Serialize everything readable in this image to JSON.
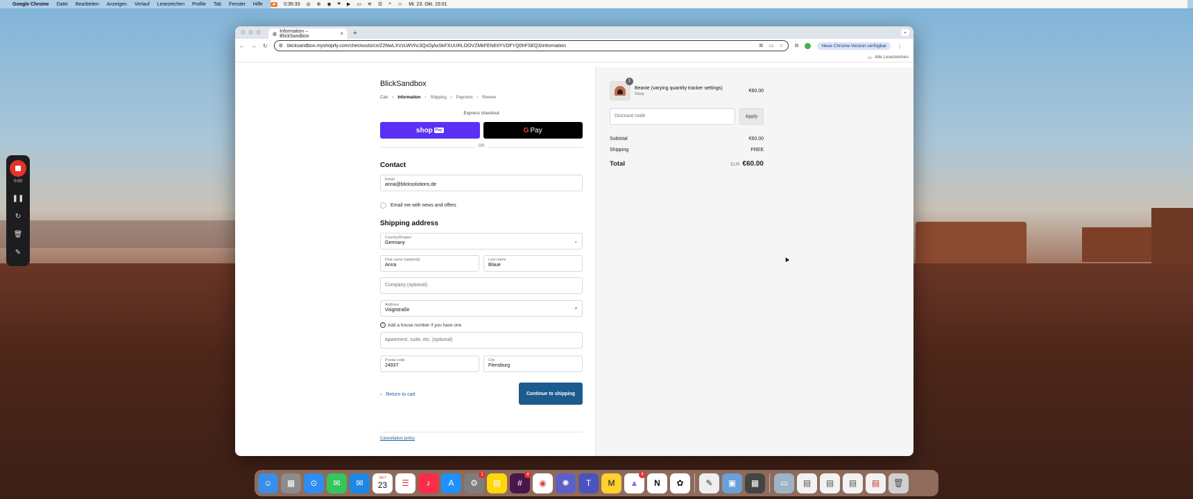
{
  "menubar": {
    "app": "Google Chrome",
    "items": [
      "Datei",
      "Bearbeiten",
      "Anzeigen",
      "Verlauf",
      "Lesezeichen",
      "Profile",
      "Tab",
      "Fenster",
      "Hilfe"
    ],
    "recording_time": "0:35:33",
    "datetime": "Mi. 23. Okt.  15:01"
  },
  "recorder": {
    "time": "0:00"
  },
  "browser": {
    "tab_title": "Information – BlickSandbox",
    "url": "blicksandbox.myshopify.com/checkouts/cn/Z2NwLXVzLWVhc3QxOjAxSkFXUURLOOVZMkFENEtlYVDFYQ0hFSEQ3/information",
    "update_label": "Neue Chrome-Version verfügbar",
    "bookmarks_label": "Alle Lesezeichen"
  },
  "checkout": {
    "store_name": "BlickSandbox",
    "breadcrumbs": [
      "Cart",
      "Information",
      "Shipping",
      "Payment",
      "Review"
    ],
    "express_label": "Express checkout",
    "shoppay_label": "shop",
    "shoppay_badge": "Pay",
    "gpay_label": "Pay",
    "or_label": "OR",
    "contact_heading": "Contact",
    "email_label": "Email",
    "email_value": "anna@blicksolutions.de",
    "newsletter_label": "Email me with news and offers",
    "shipping_heading": "Shipping address",
    "country_label": "Country/Region",
    "country_value": "Germany",
    "first_name_label": "First name (optional)",
    "first_name_value": "Anna",
    "last_name_label": "Last name",
    "last_name_value": "Blaue",
    "company_placeholder": "Company (optional)",
    "address_label": "Address",
    "address_value": "Voigtstraße",
    "address_hint": "Add a house number if you have one",
    "apartment_placeholder": "Apartment, suite, etc. (optional)",
    "postal_label": "Postal code",
    "postal_value": "24937",
    "city_label": "City",
    "city_value": "Flensburg",
    "return_label": "Return to cart",
    "continue_label": "Continue to shipping",
    "policy_label": "Cancellation policy"
  },
  "summary": {
    "product_name": "Beanie (varying quantity tracker settings)",
    "product_variant": "Navy",
    "product_qty": "1",
    "product_price": "€60.00",
    "discount_placeholder": "Discount code",
    "apply_label": "Apply",
    "subtotal_label": "Subtotal",
    "subtotal_value": "€60.00",
    "shipping_label": "Shipping",
    "shipping_value": "FREE",
    "total_label": "Total",
    "total_currency": "EUR",
    "total_value": "€60.00"
  },
  "dock": {
    "calendar_month": "OKT",
    "calendar_day": "23",
    "badges": {
      "settings": "1",
      "slack": "4",
      "clickup": "8"
    }
  }
}
